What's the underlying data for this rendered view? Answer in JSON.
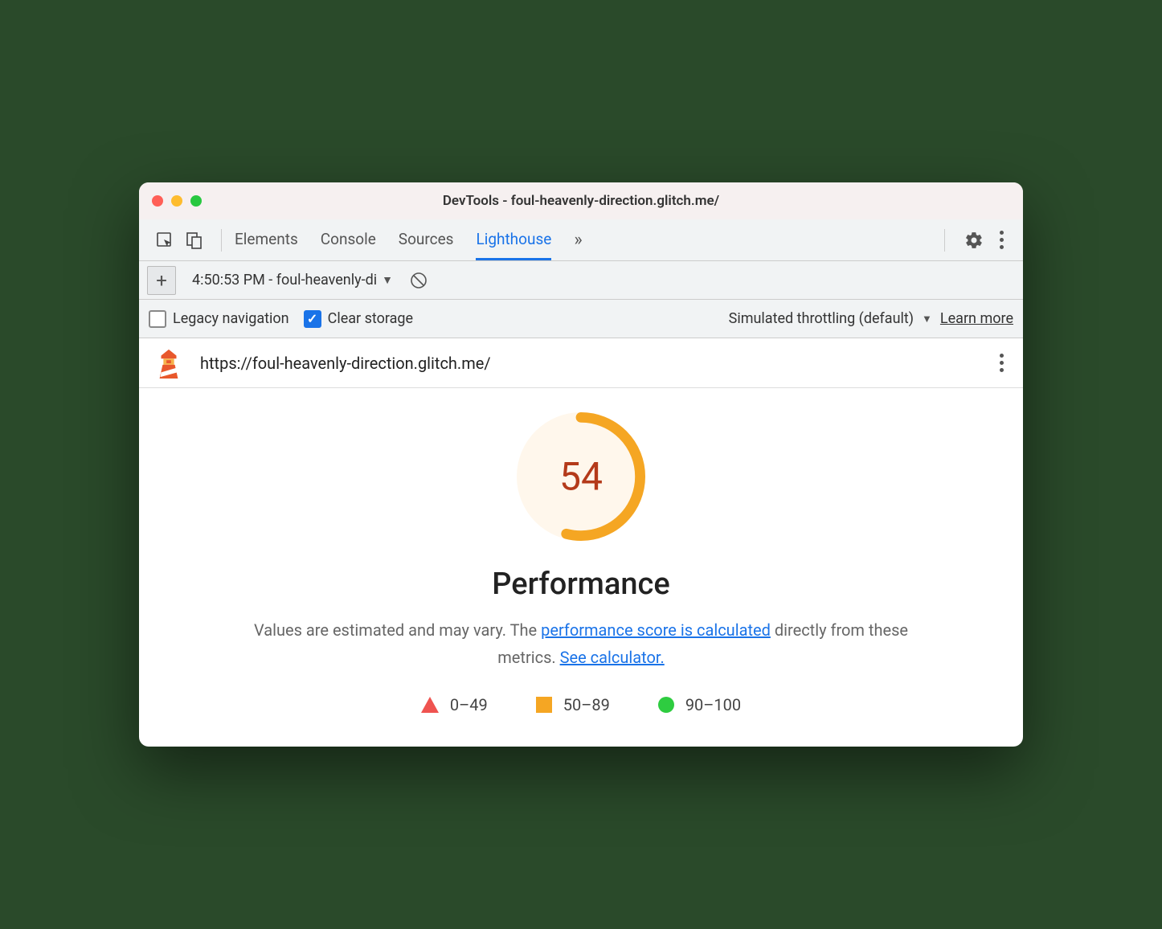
{
  "window": {
    "title": "DevTools - foul-heavenly-direction.glitch.me/"
  },
  "tabs": {
    "items": [
      "Elements",
      "Console",
      "Sources",
      "Lighthouse"
    ],
    "active": "Lighthouse"
  },
  "toolbar": {
    "report_label": "4:50:53 PM - foul-heavenly-di"
  },
  "options": {
    "legacy_label": "Legacy navigation",
    "legacy_checked": false,
    "clear_storage_label": "Clear storage",
    "clear_storage_checked": true,
    "throttling_label": "Simulated throttling (default)",
    "learn_more_label": "Learn more"
  },
  "url_row": {
    "url": "https://foul-heavenly-direction.glitch.me/"
  },
  "performance": {
    "score": "54",
    "title": "Performance",
    "desc_prefix": "Values are estimated and may vary. The ",
    "link1": "performance score is calculated",
    "desc_mid": " directly from these metrics. ",
    "link2": "See calculator."
  },
  "legend": {
    "range1": "0–49",
    "range2": "50–89",
    "range3": "90–100"
  },
  "chart_data": {
    "type": "gauge",
    "value": 54,
    "min": 0,
    "max": 100,
    "color": "#f5a623",
    "bg_color": "#fff7ec",
    "text_color": "#b43a1a",
    "thresholds": [
      {
        "range": [
          0,
          49
        ],
        "color": "#ef5350",
        "shape": "triangle"
      },
      {
        "range": [
          50,
          89
        ],
        "color": "#f5a623",
        "shape": "square"
      },
      {
        "range": [
          90,
          100
        ],
        "color": "#2ecc40",
        "shape": "circle"
      }
    ]
  }
}
